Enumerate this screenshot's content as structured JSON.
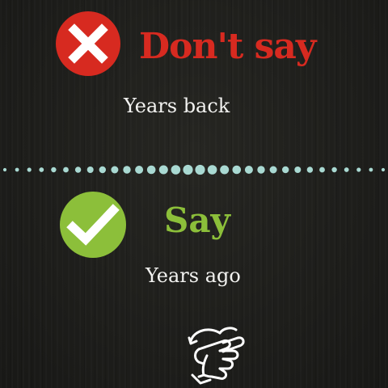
{
  "wrong": {
    "heading": "Don't say",
    "phrase": "Years back",
    "icon": "x-mark-icon",
    "color": "#d72a20"
  },
  "right": {
    "heading": "Say",
    "phrase": "Years ago",
    "icon": "check-mark-icon",
    "color": "#8cbf3a"
  },
  "divider": {
    "icon": "dotted-divider",
    "color": "#a9d9d2"
  },
  "footer": {
    "icon": "swipe-hand-icon"
  }
}
